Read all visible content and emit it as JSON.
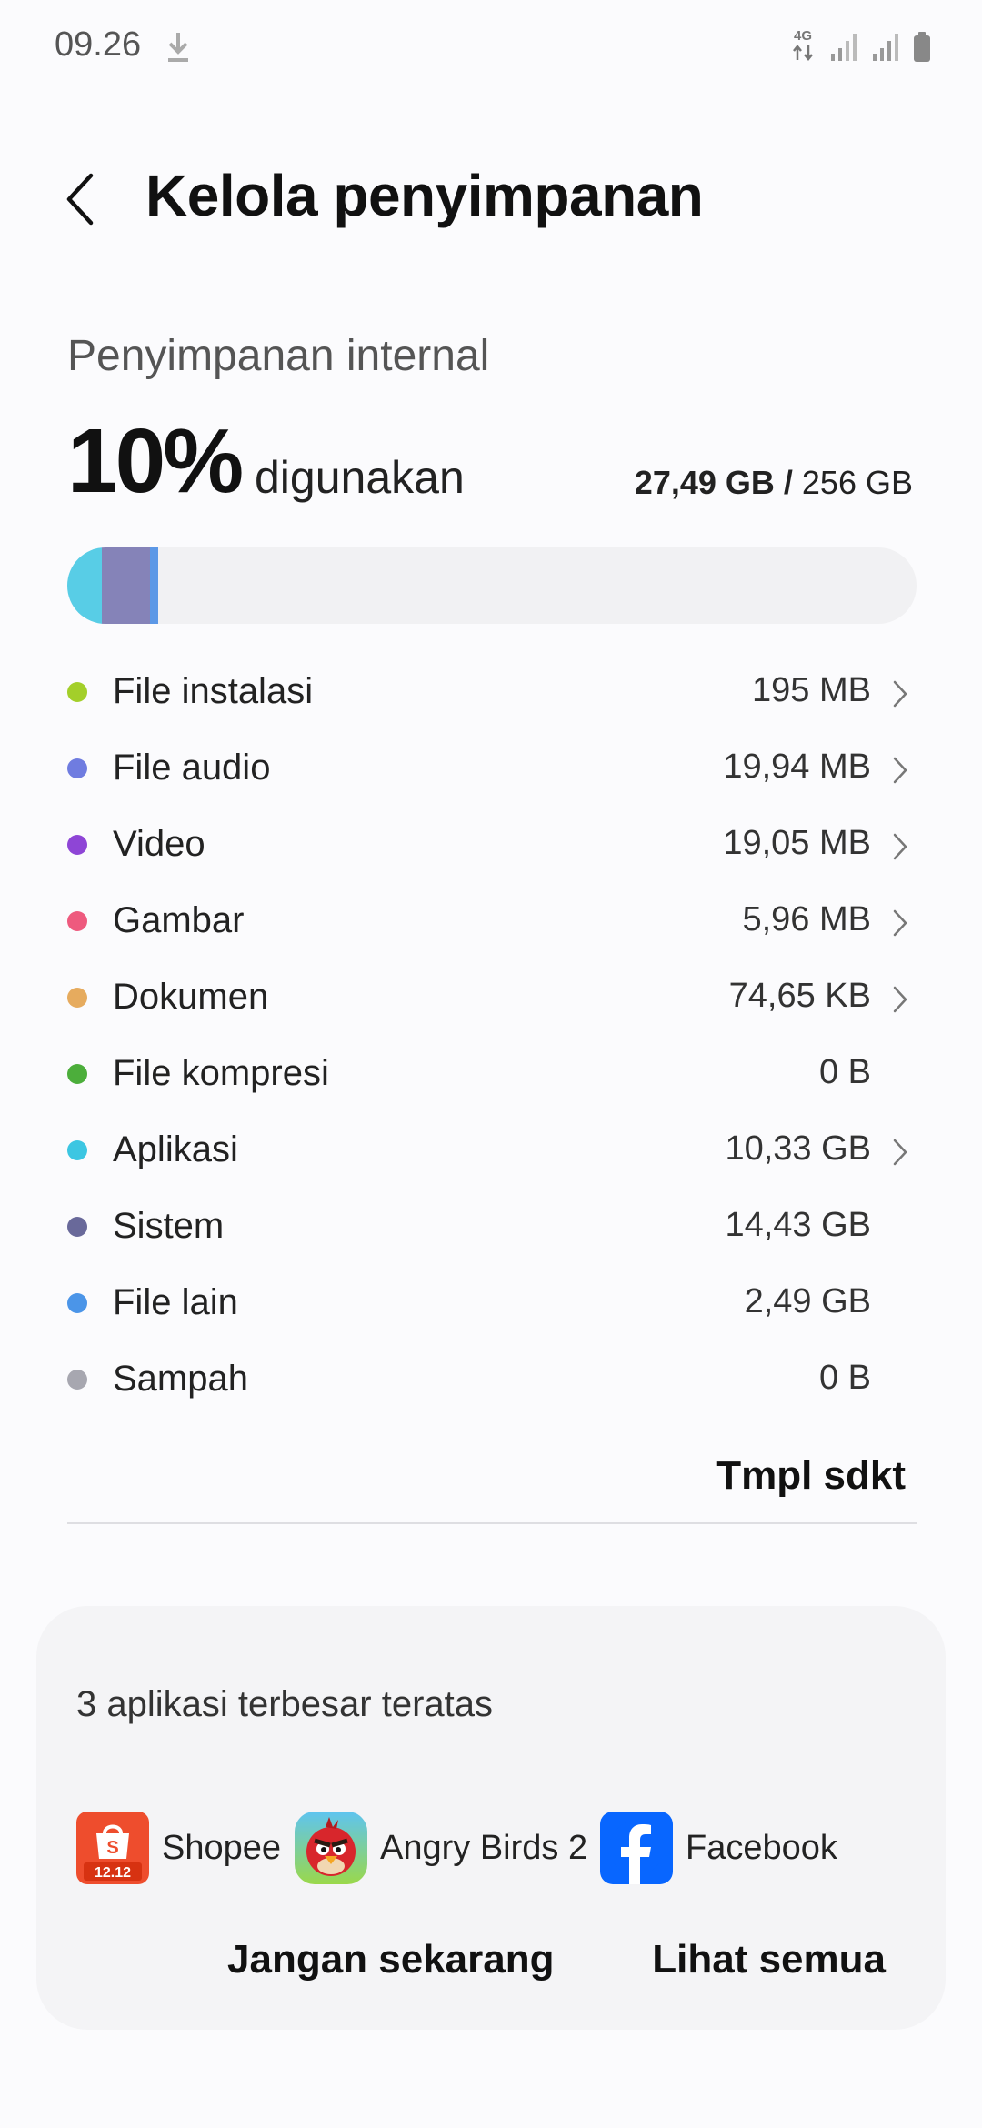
{
  "status_bar": {
    "time": "09.26",
    "network": "4G",
    "icons": [
      "download-icon",
      "data-arrows-icon",
      "signal-icon",
      "signal-icon",
      "battery-icon"
    ]
  },
  "header": {
    "back_icon": "chevron-left-icon",
    "title": "Kelola penyimpanan"
  },
  "storage": {
    "section_label": "Penyimpanan internal",
    "used_percent": "10%",
    "used_word": "digunakan",
    "used_amount": "27,49 GB",
    "separator": " / ",
    "total_amount": "256 GB",
    "bar_segments": [
      {
        "name": "Aplikasi",
        "fraction": 0.0403,
        "color": "#58cde6"
      },
      {
        "name": "Sistem",
        "fraction": 0.0564,
        "color": "#8583b8"
      },
      {
        "name": "File lain",
        "fraction": 0.0097,
        "color": "#5c98e6"
      }
    ]
  },
  "categories": [
    {
      "name": "File instalasi",
      "size": "195 MB",
      "color": "#a3cf2a",
      "chevron": true
    },
    {
      "name": "File audio",
      "size": "19,94 MB",
      "color": "#6f7ce0",
      "chevron": true
    },
    {
      "name": "Video",
      "size": "19,05 MB",
      "color": "#8e45d6",
      "chevron": true
    },
    {
      "name": "Gambar",
      "size": "5,96 MB",
      "color": "#ee5a7e",
      "chevron": true
    },
    {
      "name": "Dokumen",
      "size": "74,65 KB",
      "color": "#e6ab5e",
      "chevron": true
    },
    {
      "name": "File kompresi",
      "size": "0 B",
      "color": "#4cae3b",
      "chevron": false
    },
    {
      "name": "Aplikasi",
      "size": "10,33 GB",
      "color": "#3cc6e2",
      "chevron": true
    },
    {
      "name": "Sistem",
      "size": "14,43 GB",
      "color": "#69699a",
      "chevron": false
    },
    {
      "name": "File lain",
      "size": "2,49 GB",
      "color": "#4b95e8",
      "chevron": false
    },
    {
      "name": "Sampah",
      "size": "0 B",
      "color": "#a7a7b0",
      "chevron": false
    }
  ],
  "show_less_label": "Tmpl sdkt",
  "top_apps": {
    "title": "3 aplikasi terbesar teratas",
    "apps": [
      {
        "name": "Shopee",
        "icon": "shopee-icon",
        "badge": "12.12"
      },
      {
        "name": "Angry Birds 2",
        "icon": "angry-birds-icon"
      },
      {
        "name": "Facebook",
        "icon": "facebook-icon"
      }
    ],
    "dismiss_label": "Jangan sekarang",
    "view_all_label": "Lihat semua"
  }
}
